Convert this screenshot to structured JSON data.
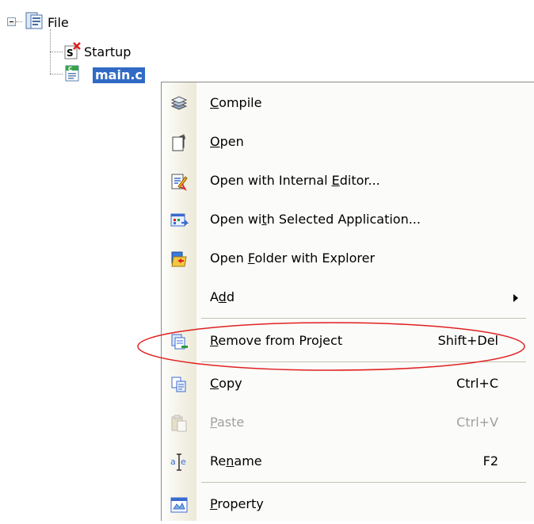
{
  "tree": {
    "root_label": "File",
    "children": [
      {
        "label": "Startup"
      },
      {
        "label": "main.c"
      }
    ]
  },
  "menu": {
    "items": [
      {
        "icon": "compile-icon",
        "label": "Compile",
        "mnemonic_index": 0
      },
      {
        "icon": "open-icon",
        "label": "Open",
        "mnemonic_index": 0
      },
      {
        "icon": "open-internal-editor-icon",
        "label": "Open with Internal Editor...",
        "mnemonic_index": 19
      },
      {
        "icon": "open-selected-app-icon",
        "label": "Open with Selected Application...",
        "mnemonic_index": 7
      },
      {
        "icon": "open-folder-icon",
        "label": "Open Folder with Explorer",
        "mnemonic_index": 5
      },
      {
        "icon": "",
        "label": "Add",
        "mnemonic_index": 1,
        "submenu": true
      },
      {
        "icon": "remove-from-project-icon",
        "label": "Remove from Project",
        "mnemonic_index": 0,
        "shortcut": "Shift+Del"
      },
      {
        "icon": "copy-icon",
        "label": "Copy",
        "mnemonic_index": 0,
        "shortcut": "Ctrl+C"
      },
      {
        "icon": "paste-icon",
        "label": "Paste",
        "mnemonic_index": 0,
        "shortcut": "Ctrl+V",
        "disabled": true
      },
      {
        "icon": "rename-icon",
        "label": "Rename",
        "mnemonic_index": 2,
        "shortcut": "F2"
      },
      {
        "icon": "property-icon",
        "label": "Property",
        "mnemonic_index": 0
      }
    ]
  },
  "colors": {
    "selection": "#316ac5",
    "highlight_oval": "#e02020",
    "disabled_text": "#a0a0a0"
  }
}
